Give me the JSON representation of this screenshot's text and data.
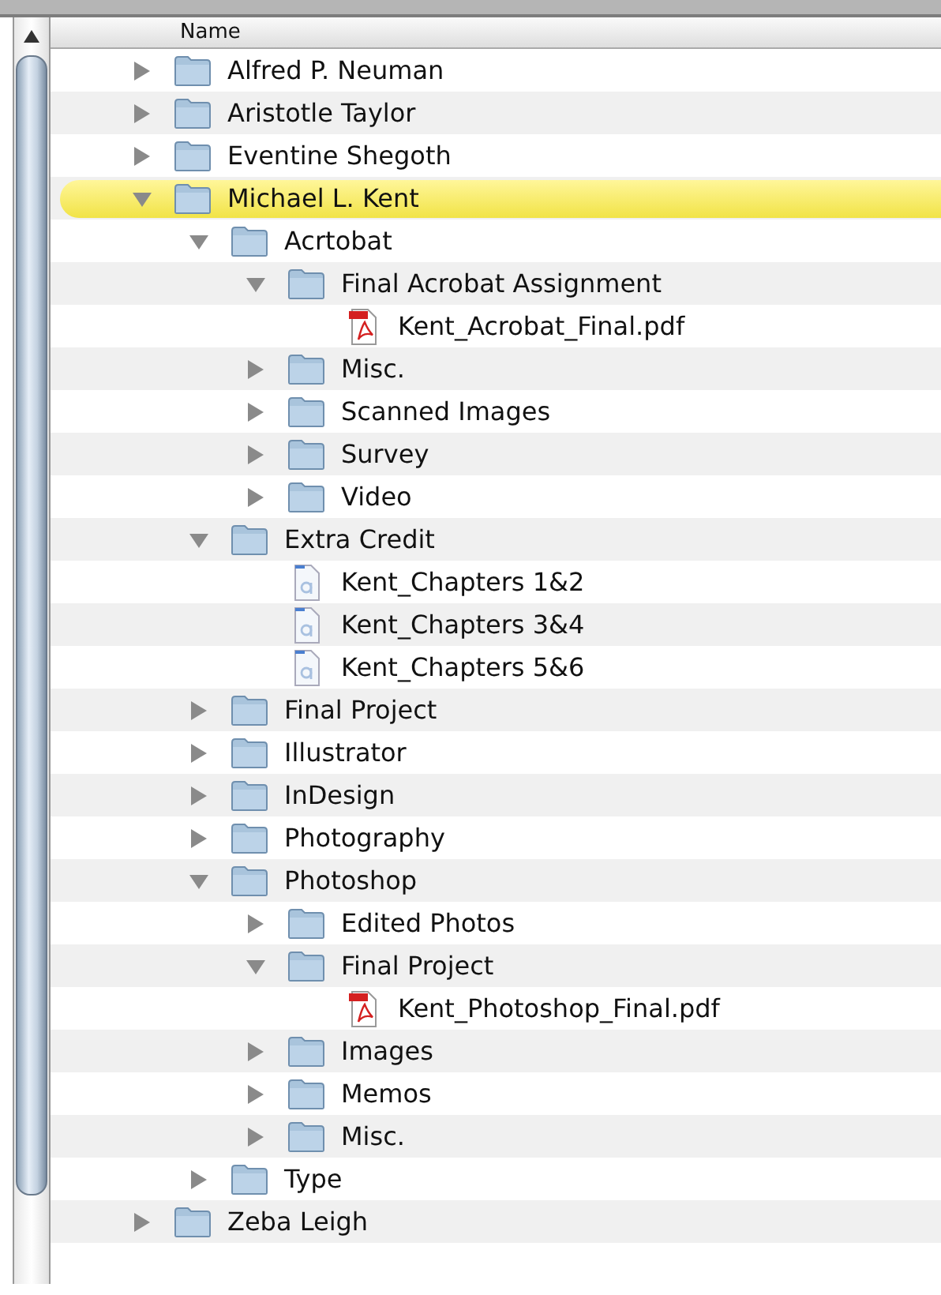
{
  "header": {
    "column": "Name"
  },
  "tree": [
    {
      "name": "Alfred P. Neuman",
      "kind": "folder",
      "expanded": false,
      "selected": false
    },
    {
      "name": "Aristotle Taylor",
      "kind": "folder",
      "expanded": false,
      "selected": false
    },
    {
      "name": "Eventine Shegoth",
      "kind": "folder",
      "expanded": false,
      "selected": false
    },
    {
      "name": "Michael L. Kent",
      "kind": "folder",
      "expanded": true,
      "selected": true,
      "children": [
        {
          "name": "Acrtobat",
          "kind": "folder",
          "expanded": true,
          "selected": false,
          "children": [
            {
              "name": "Final Acrobat Assignment",
              "kind": "folder",
              "expanded": true,
              "selected": false,
              "children": [
                {
                  "name": "Kent_Acrobat_Final.pdf",
                  "kind": "pdf",
                  "selected": false
                }
              ]
            },
            {
              "name": "Misc.",
              "kind": "folder",
              "expanded": false,
              "selected": false
            },
            {
              "name": "Scanned Images",
              "kind": "folder",
              "expanded": false,
              "selected": false
            },
            {
              "name": "Survey",
              "kind": "folder",
              "expanded": false,
              "selected": false
            },
            {
              "name": "Video",
              "kind": "folder",
              "expanded": false,
              "selected": false
            }
          ]
        },
        {
          "name": "Extra Credit",
          "kind": "folder",
          "expanded": true,
          "selected": false,
          "children": [
            {
              "name": "Kent_Chapters 1&2",
              "kind": "text",
              "selected": false
            },
            {
              "name": "Kent_Chapters 3&4",
              "kind": "text",
              "selected": false
            },
            {
              "name": "Kent_Chapters 5&6",
              "kind": "text",
              "selected": false
            }
          ]
        },
        {
          "name": "Final Project",
          "kind": "folder",
          "expanded": false,
          "selected": false
        },
        {
          "name": "Illustrator",
          "kind": "folder",
          "expanded": false,
          "selected": false
        },
        {
          "name": "InDesign",
          "kind": "folder",
          "expanded": false,
          "selected": false
        },
        {
          "name": "Photography",
          "kind": "folder",
          "expanded": false,
          "selected": false
        },
        {
          "name": "Photoshop",
          "kind": "folder",
          "expanded": true,
          "selected": false,
          "children": [
            {
              "name": "Edited Photos",
              "kind": "folder",
              "expanded": false,
              "selected": false
            },
            {
              "name": "Final Project",
              "kind": "folder",
              "expanded": true,
              "selected": false,
              "children": [
                {
                  "name": "Kent_Photoshop_Final.pdf",
                  "kind": "pdf",
                  "selected": false
                }
              ]
            },
            {
              "name": "Images",
              "kind": "folder",
              "expanded": false,
              "selected": false
            },
            {
              "name": "Memos",
              "kind": "folder",
              "expanded": false,
              "selected": false
            },
            {
              "name": "Misc.",
              "kind": "folder",
              "expanded": false,
              "selected": false
            }
          ]
        },
        {
          "name": "Type",
          "kind": "folder",
          "expanded": false,
          "selected": false
        }
      ]
    },
    {
      "name": "Zeba Leigh",
      "kind": "folder",
      "expanded": false,
      "selected": false
    }
  ]
}
